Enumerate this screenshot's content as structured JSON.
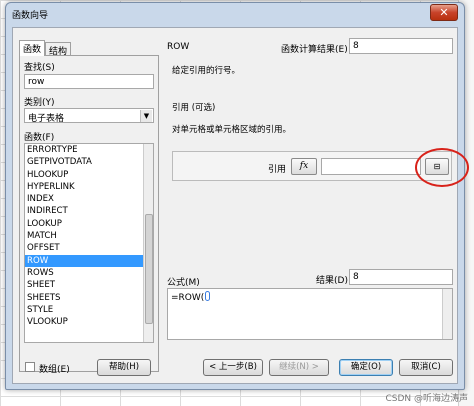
{
  "dialog": {
    "title": "函数向导",
    "close_symbol": "✕"
  },
  "left_panel": {
    "tabs": [
      "函数",
      "结构"
    ],
    "search_label": "查找(S)",
    "search_value": "row",
    "category_label": "类别(Y)",
    "category_value": "电子表格",
    "function_label": "函数(F)",
    "functions": [
      "ERRORTYPE",
      "GETPIVOTDATA",
      "HLOOKUP",
      "HYPERLINK",
      "INDEX",
      "INDIRECT",
      "LOOKUP",
      "MATCH",
      "OFFSET",
      "ROW",
      "ROWS",
      "SHEET",
      "SHEETS",
      "STYLE",
      "VLOOKUP"
    ],
    "selected_function": "ROW"
  },
  "right_panel": {
    "function_name": "ROW",
    "result_label": "函数计算结果(E)",
    "result_value": "8",
    "description": "给定引用的行号。",
    "argument_title": "引用 (可选)",
    "argument_description": "对单元格或单元格区域的引用。",
    "argument_label": "引用",
    "argument_value": "",
    "fx_label": "fx",
    "shrink_symbol": "⊟",
    "formula_label": "公式(M)",
    "formula_value": "=ROW(",
    "result2_label": "结果(D)",
    "result2_value": "8"
  },
  "footer": {
    "array_checkbox_label": "数组(E)",
    "help_button": "帮助(H)",
    "prev_button": "< 上一步(B)",
    "next_button": "继续(N) >",
    "ok_button": "确定(O)",
    "cancel_button": "取消(C)"
  },
  "watermark": "CSDN @听海边涛声",
  "colors": {
    "selection": "#3399ff",
    "annotation_circle": "#d8221a",
    "title_bar": "#c9d8ea"
  }
}
